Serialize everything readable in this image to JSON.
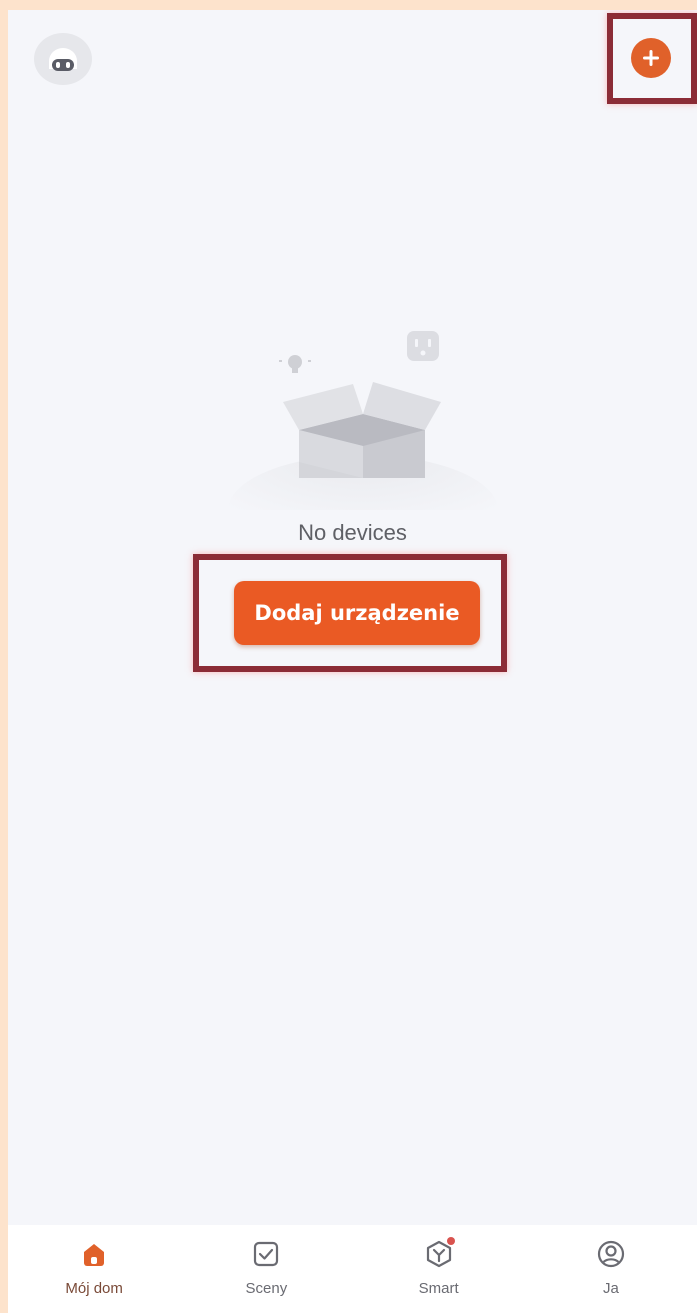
{
  "header": {
    "avatar_icon": "robot-avatar-icon",
    "add_icon": "plus-icon"
  },
  "empty_state": {
    "illustration": "empty-box-icon",
    "message": "No devices",
    "cta_label": "Dodaj urządzenie"
  },
  "tabbar": {
    "tabs": [
      {
        "label": "Mój dom",
        "icon": "home-icon",
        "active": true
      },
      {
        "label": "Sceny",
        "icon": "checkbox-icon",
        "active": false
      },
      {
        "label": "Smart",
        "icon": "smart-cube-icon",
        "active": false,
        "badge": true
      },
      {
        "label": "Ja",
        "icon": "user-icon",
        "active": false
      }
    ]
  },
  "colors": {
    "accent": "#ea5a24",
    "background": "#f5f6fa",
    "highlight_border": "#8b2c36"
  }
}
